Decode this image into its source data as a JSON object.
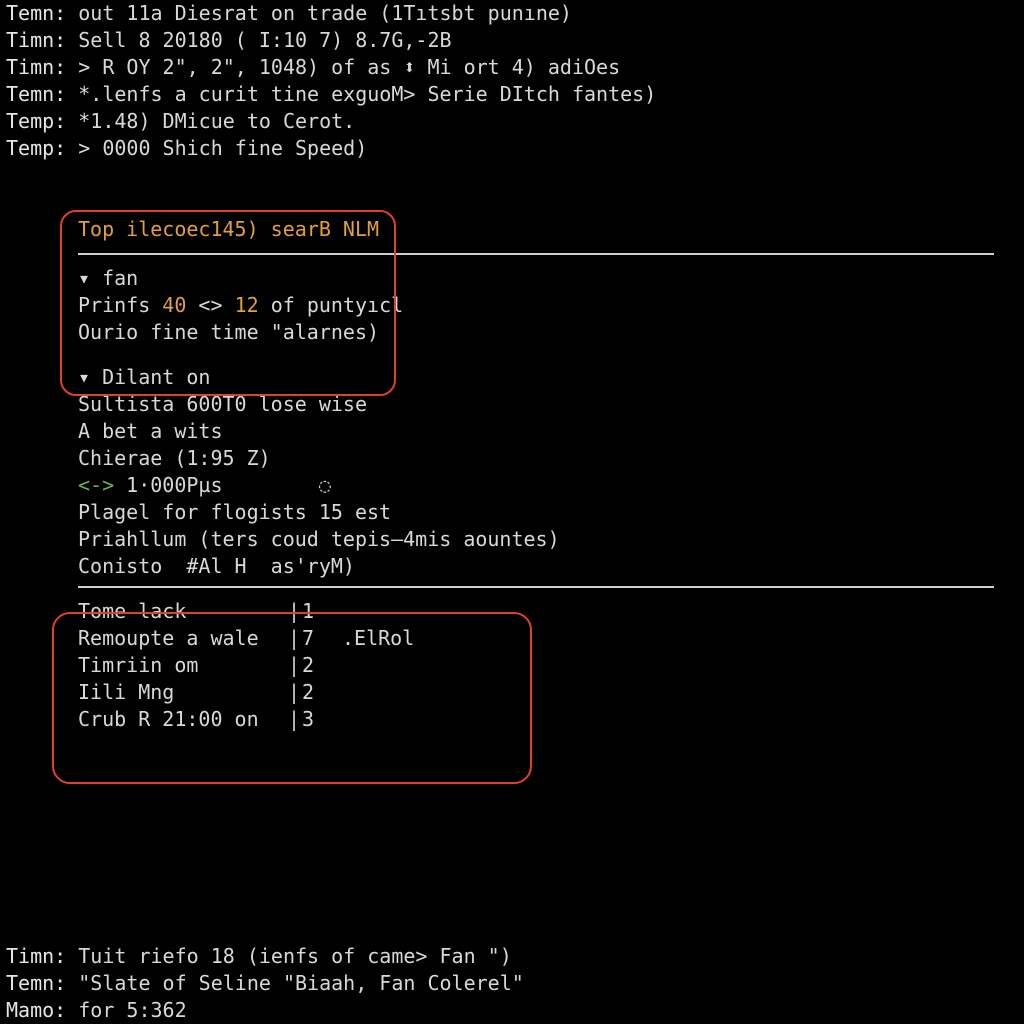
{
  "top": [
    {
      "label": "Temn:",
      "text": "out 11a Diesrat on trade (1Tıtsbt punıne)"
    },
    {
      "label": "Timn:",
      "text": "Sell 8 20180 ( I:10 7) 8.7G,-2B"
    },
    {
      "label": "Timn:",
      "text": "> R OY 2\", 2\", 1048) of as ⬍ Mi ort 4) adiOes"
    },
    {
      "label": "Temn:",
      "text": "*.lenfs a curit tine exguoM> Serie DItch fantes)"
    },
    {
      "label": "Temp:",
      "text": "*1.48) DMicue to Cerot."
    },
    {
      "label": "Temp:",
      "text": "> 0000 Shich fine Speed)"
    }
  ],
  "panel": {
    "title": "Top ilecoec145) searB NLM",
    "section1": {
      "header": "▾ fan",
      "line1_pre": "Prinfs ",
      "line1_n1": "40",
      "line1_mid": " <> ",
      "line1_n2": "12",
      "line1_post": " of puntyıcl",
      "line2": "Ourio fine time \"alarnes)"
    },
    "section2": {
      "header": "▾ Dilant on",
      "l1": "Sultista 600T0 lose wise",
      "l2": "A bet a wits",
      "l3": "Chierae (1:95 Z)",
      "l4_pre": "<-> ",
      "l4_val": "1·000Pµs",
      "l4_spin": "◌",
      "l5": "Plagel for flogists 15 est",
      "l6": "Priahllum (ters coud tepis—4mis aountes)",
      "l7": "Conisto  #Al H  as'ryM)"
    },
    "table": [
      {
        "c1": "Tome lack",
        "c2": "1",
        "c3": ""
      },
      {
        "c1": "Remoupte a wale",
        "c2": "7",
        "c3": ".ElRol"
      },
      {
        "c1": "Timriin om",
        "c2": "2",
        "c3": ""
      },
      {
        "c1": "Iili Mng",
        "c2": "2",
        "c3": ""
      },
      {
        "c1": "Crub R 21:00 on",
        "c2": "3",
        "c3": ""
      }
    ]
  },
  "bottom": [
    {
      "label": "Timn:",
      "text": "Tuit riefo 18 (ienfs of came> Fan \")"
    },
    {
      "label": "Temn:",
      "text": "\"Slate of Seline \"Biaah, Fan Colerel\""
    },
    {
      "label": "Mamo:",
      "text": "for 5:362"
    }
  ]
}
